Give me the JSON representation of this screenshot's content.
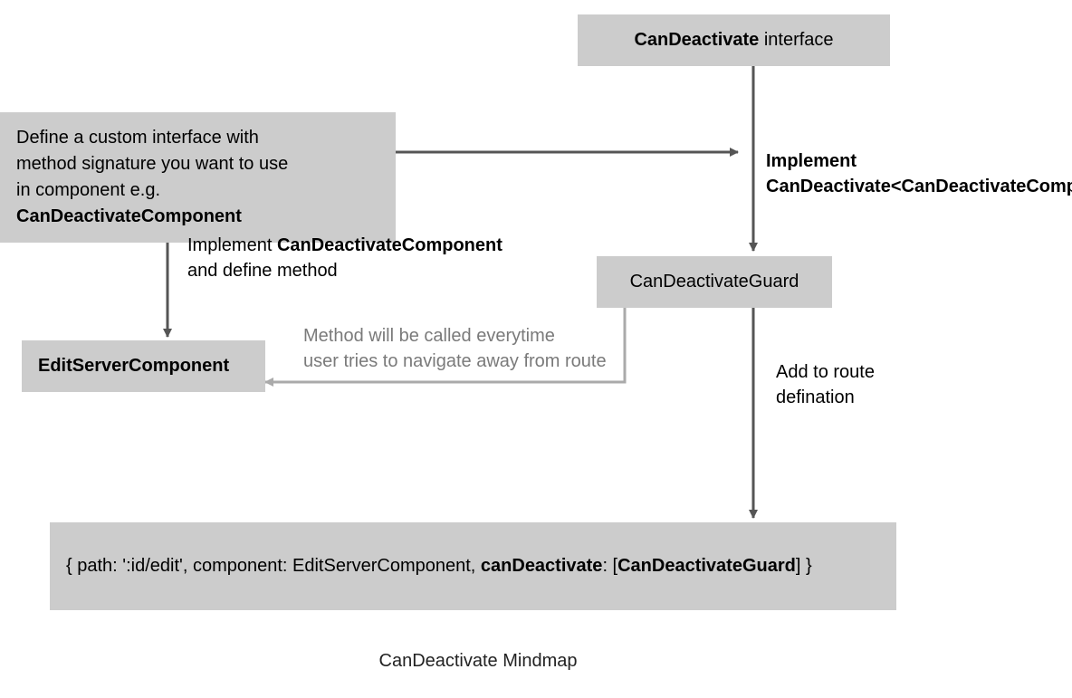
{
  "nodes": {
    "interface": {
      "bold": "CanDeactivate",
      "rest": " interface"
    },
    "customInterface": {
      "line1": "Define a custom interface with",
      "line2": "method signature you want to use",
      "line3_pre": "in component e.g. ",
      "line3_bold": "CanDeactivateComponent"
    },
    "guard": "CanDeactivateGuard",
    "editServer": "EditServerComponent",
    "route": {
      "pre": "{ path: ':id/edit', component: EditServerComponent, ",
      "bold1": "canDeactivate",
      "mid": ": [",
      "bold2": "CanDeactivateGuard",
      "post": "] }"
    }
  },
  "labels": {
    "implementGuard": {
      "line1": "Implement",
      "line2": "CanDeactivate<CanDeactivateComponent>"
    },
    "implementComponent": {
      "pre": "Implement ",
      "bold": "CanDeactivateComponent",
      "line2": "and define method"
    },
    "methodCalled": {
      "line1": "Method will be called everytime",
      "line2": "user tries to navigate away from route"
    },
    "addRoute": {
      "line1": "Add to route",
      "line2": "defination"
    }
  },
  "caption": "CanDeactivate Mindmap"
}
